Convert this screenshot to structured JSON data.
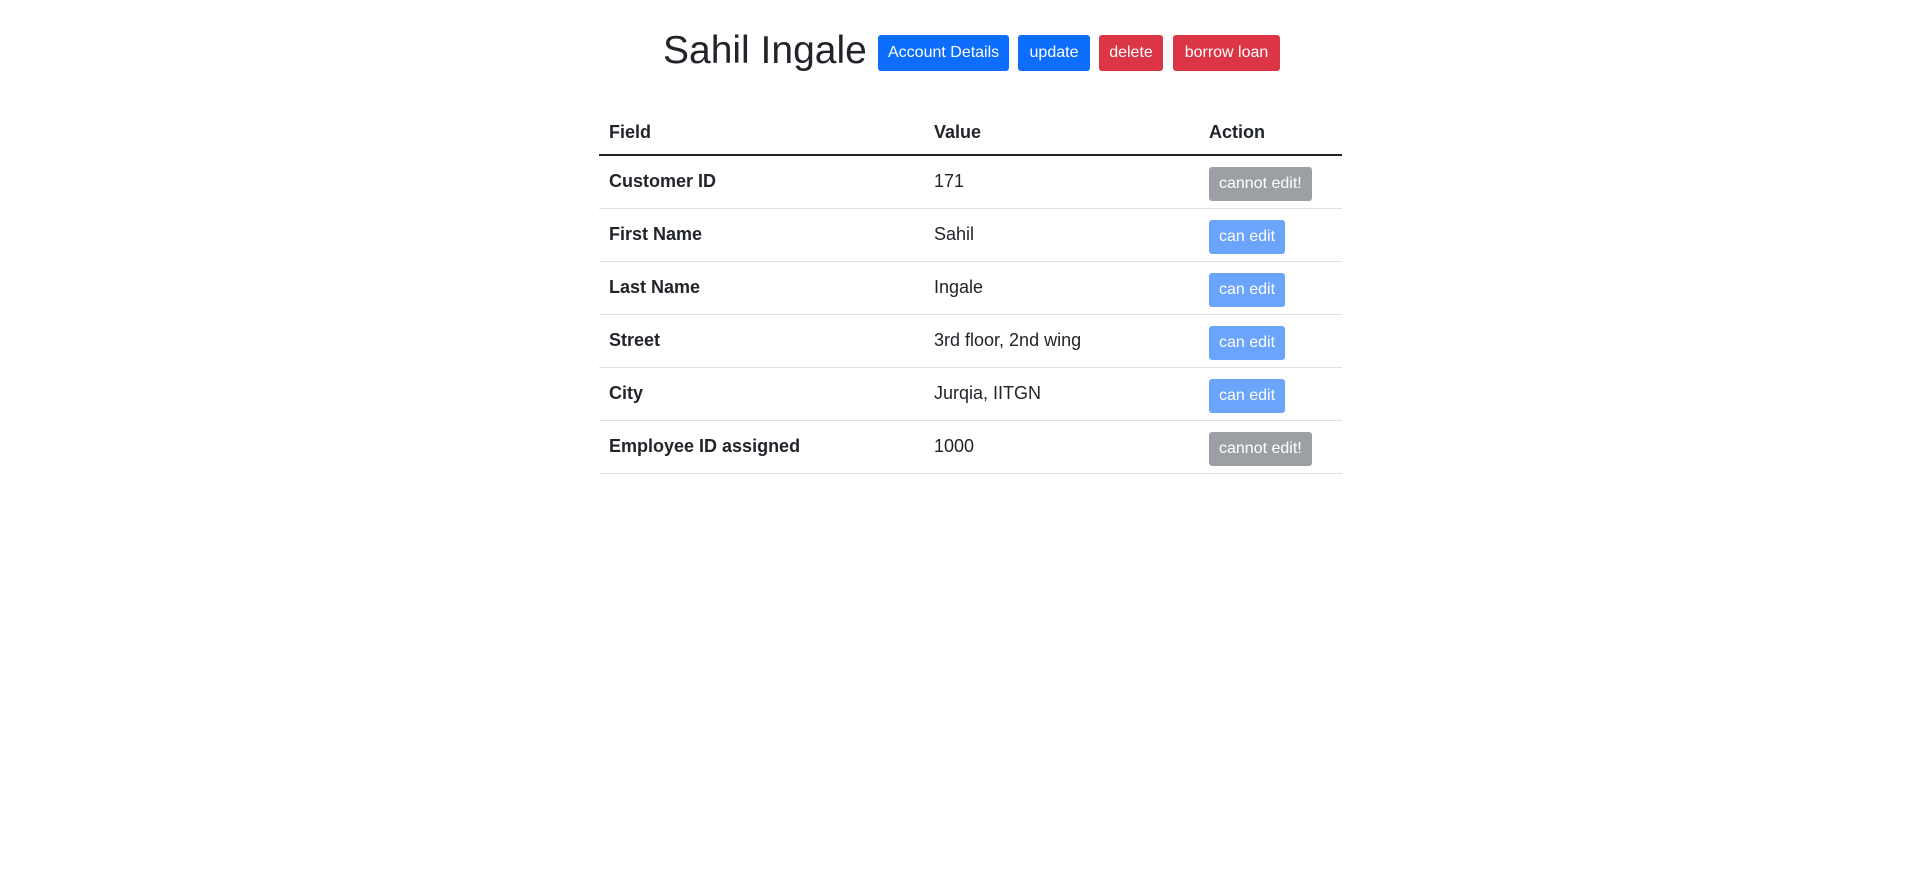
{
  "header": {
    "title": "Sahil Ingale",
    "buttons": {
      "account_details": "Account Details",
      "update": "update",
      "delete": "delete",
      "borrow_loan": "borrow loan"
    }
  },
  "table": {
    "columns": [
      "Field",
      "Value",
      "Action"
    ],
    "rows": [
      {
        "field": "Customer ID",
        "value": "171",
        "action": "cannot edit!",
        "editable": false
      },
      {
        "field": "First Name",
        "value": "Sahil",
        "action": "can edit",
        "editable": true
      },
      {
        "field": "Last Name",
        "value": "Ingale",
        "action": "can edit",
        "editable": true
      },
      {
        "field": "Street",
        "value": "3rd floor, 2nd wing",
        "action": "can edit",
        "editable": true
      },
      {
        "field": "City",
        "value": "Jurqia, IITGN",
        "action": "can edit",
        "editable": true
      },
      {
        "field": "Employee ID assigned",
        "value": "1000",
        "action": "cannot edit!",
        "editable": false
      }
    ]
  },
  "colors": {
    "primary": "#0d6efd",
    "danger": "#dc3545",
    "can_edit": "#6aa4fb",
    "cannot_edit": "#9ca0a5"
  }
}
